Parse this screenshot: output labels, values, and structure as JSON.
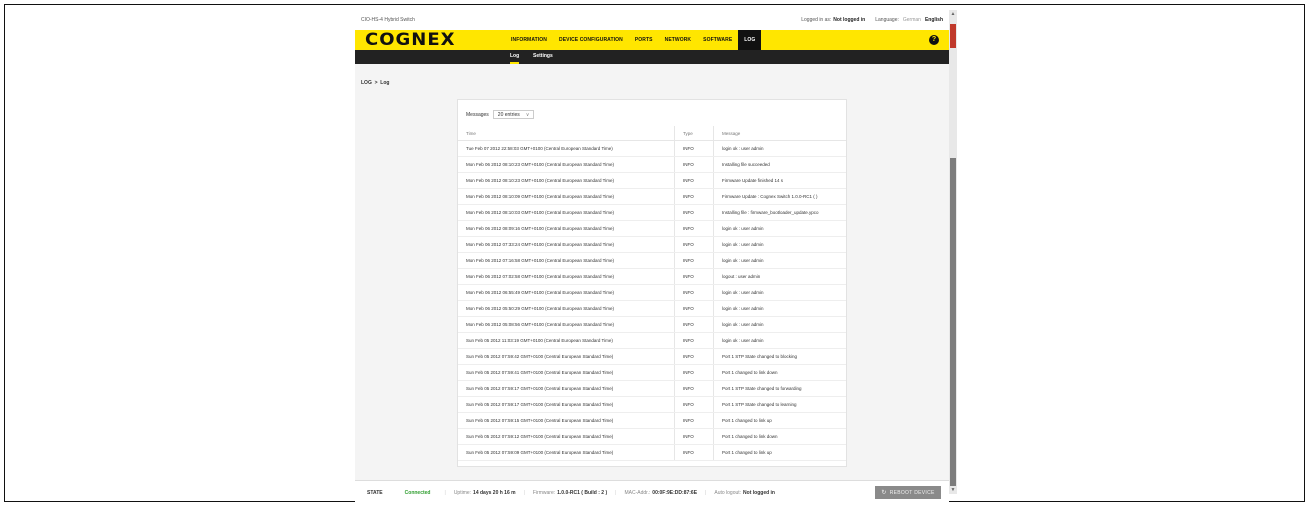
{
  "app": {
    "device_name": "CIO-HS-4 Hybrid Switch",
    "logged_in_label": "Logged in as:",
    "logged_in_value": "Not logged in",
    "language_label": "Language:",
    "lang_german": "German",
    "lang_english": "English"
  },
  "brand": {
    "logo_text": "COGNEX",
    "accent_color": "#ffe600"
  },
  "nav": {
    "items": [
      {
        "label": "INFORMATION"
      },
      {
        "label": "DEVICE CONFIGURATION"
      },
      {
        "label": "PORTS"
      },
      {
        "label": "NETWORK"
      },
      {
        "label": "SOFTWARE"
      },
      {
        "label": "LOG",
        "active": true
      }
    ],
    "help_icon": "?"
  },
  "subnav": {
    "tabs": [
      {
        "label": "Log",
        "active": true
      },
      {
        "label": "Settings"
      }
    ]
  },
  "breadcrumb": "LOG  >  Log",
  "messages_filter": {
    "label": "Messages",
    "selected": "20 entries",
    "chevron": "∨"
  },
  "table": {
    "headers": {
      "time": "Time",
      "type": "Type",
      "message": "Message"
    },
    "rows": [
      {
        "time": "Tue Feb 07 2012 22:58:03 GMT+0100 (Central European Standard Time)",
        "type": "INFO",
        "message": "login ok : user admin"
      },
      {
        "time": "Mon Feb 06 2012 08:10:23 GMT+0100 (Central European Standard Time)",
        "type": "INFO",
        "message": "Installing file succeeded"
      },
      {
        "time": "Mon Feb 06 2012 08:10:23 GMT+0100 (Central European Standard Time)",
        "type": "INFO",
        "message": "Firmware Update finished 14 s"
      },
      {
        "time": "Mon Feb 06 2012 08:10:09 GMT+0100 (Central European Standard Time)",
        "type": "INFO",
        "message": "Firmware Update : Cognex Switch 1.0.0-RC1 ( )"
      },
      {
        "time": "Mon Feb 06 2012 08:10:03 GMT+0100 (Central European Standard Time)",
        "type": "INFO",
        "message": "Installing file : firmware_bootloader_update.ypco"
      },
      {
        "time": "Mon Feb 06 2012 08:09:16 GMT+0100 (Central European Standard Time)",
        "type": "INFO",
        "message": "login ok : user admin"
      },
      {
        "time": "Mon Feb 06 2012 07:33:24 GMT+0100 (Central European Standard Time)",
        "type": "INFO",
        "message": "login ok : user admin"
      },
      {
        "time": "Mon Feb 06 2012 07:16:58 GMT+0100 (Central European Standard Time)",
        "type": "INFO",
        "message": "login ok : user admin"
      },
      {
        "time": "Mon Feb 06 2012 07:02:58 GMT+0100 (Central European Standard Time)",
        "type": "INFO",
        "message": "logout : user admin"
      },
      {
        "time": "Mon Feb 06 2012 06:55:49 GMT+0100 (Central European Standard Time)",
        "type": "INFO",
        "message": "login ok : user admin"
      },
      {
        "time": "Mon Feb 06 2012 05:50:29 GMT+0100 (Central European Standard Time)",
        "type": "INFO",
        "message": "login ok : user admin"
      },
      {
        "time": "Mon Feb 06 2012 05:08:56 GMT+0100 (Central European Standard Time)",
        "type": "INFO",
        "message": "login ok : user admin"
      },
      {
        "time": "Sun Feb 05 2012 11:03:19 GMT+0100 (Central European Standard Time)",
        "type": "INFO",
        "message": "login ok : user admin"
      },
      {
        "time": "Sun Feb 05 2012 07:59:42 GMT+0100 (Central European Standard Time)",
        "type": "INFO",
        "message": "Port 1 STP State changed to blocking"
      },
      {
        "time": "Sun Feb 05 2012 07:59:41 GMT+0100 (Central European Standard Time)",
        "type": "INFO",
        "message": "Port 1 changed to link down"
      },
      {
        "time": "Sun Feb 05 2012 07:59:17 GMT+0100 (Central European Standard Time)",
        "type": "INFO",
        "message": "Port 1 STP State changed to forwarding"
      },
      {
        "time": "Sun Feb 05 2012 07:59:17 GMT+0100 (Central European Standard Time)",
        "type": "INFO",
        "message": "Port 1 STP State changed to learning"
      },
      {
        "time": "Sun Feb 05 2012 07:59:15 GMT+0100 (Central European Standard Time)",
        "type": "INFO",
        "message": "Port 1 changed to link up"
      },
      {
        "time": "Sun Feb 05 2012 07:59:12 GMT+0100 (Central European Standard Time)",
        "type": "INFO",
        "message": "Port 1 changed to link down"
      },
      {
        "time": "Sun Feb 05 2012 07:59:09 GMT+0100 (Central European Standard Time)",
        "type": "INFO",
        "message": "Port 1 changed to link up"
      }
    ]
  },
  "status": {
    "state_label": "STATE",
    "connected": "Connected",
    "connected_color": "#2f9e2f",
    "uptime_label": "Uptime:",
    "uptime_value": "14 days 20 h 16 m",
    "firmware_label": "Firmware:",
    "firmware_value": "1.0.0-RC1 ( Build : 2 )",
    "mac_label": "MAC-Addr.:",
    "mac_value": "00:0F:9E:DD:87:6E",
    "autologout_label": "Auto logout:",
    "autologout_value": "Not logged in",
    "reboot_label": "REBOOT DEVICE",
    "reboot_icon": "↻"
  }
}
